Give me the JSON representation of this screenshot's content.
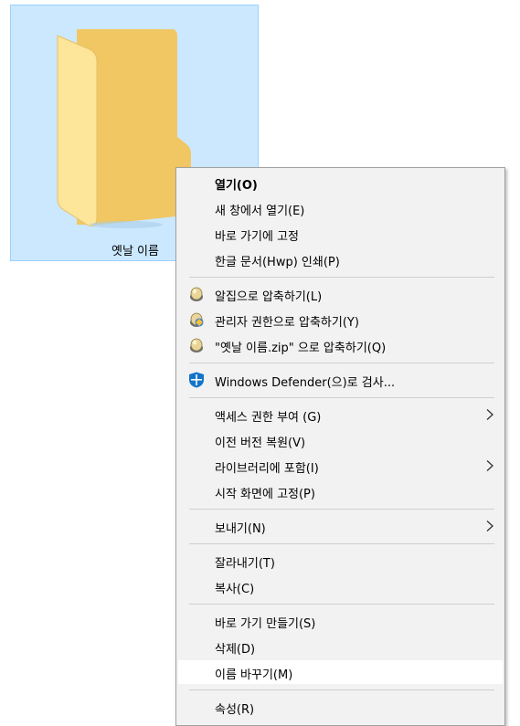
{
  "folder": {
    "name": "옛날 이름"
  },
  "menu": {
    "groups": [
      [
        {
          "label": "열기(O)",
          "icon": "",
          "submenu": false,
          "bold": true
        },
        {
          "label": "새 창에서 열기(E)",
          "icon": "",
          "submenu": false
        },
        {
          "label": "바로 가기에 고정",
          "icon": "",
          "submenu": false
        },
        {
          "label": "한글 문서(Hwp) 인쇄(P)",
          "icon": "",
          "submenu": false
        }
      ],
      [
        {
          "label": "알집으로 압축하기(L)",
          "icon": "alzip-icon",
          "submenu": false
        },
        {
          "label": "관리자 권한으로 압축하기(Y)",
          "icon": "alzip-admin-icon",
          "submenu": false
        },
        {
          "label": "\"옛날 이름.zip\" 으로 압축하기(Q)",
          "icon": "alzip-icon",
          "submenu": false
        }
      ],
      [
        {
          "label": "Windows Defender(으)로 검사...",
          "icon": "windows-defender-icon",
          "submenu": false
        }
      ],
      [
        {
          "label": "액세스 권한 부여 (G)",
          "icon": "",
          "submenu": true
        },
        {
          "label": "이전 버전 복원(V)",
          "icon": "",
          "submenu": false
        },
        {
          "label": "라이브러리에 포함(I)",
          "icon": "",
          "submenu": true
        },
        {
          "label": "시작 화면에 고정(P)",
          "icon": "",
          "submenu": false
        }
      ],
      [
        {
          "label": "보내기(N)",
          "icon": "",
          "submenu": true
        }
      ],
      [
        {
          "label": "잘라내기(T)",
          "icon": "",
          "submenu": false
        },
        {
          "label": "복사(C)",
          "icon": "",
          "submenu": false
        }
      ],
      [
        {
          "label": "바로 가기 만들기(S)",
          "icon": "",
          "submenu": false
        },
        {
          "label": "삭제(D)",
          "icon": "",
          "submenu": false
        },
        {
          "label": "이름 바꾸기(M)",
          "icon": "",
          "submenu": false,
          "hovered": true
        }
      ],
      [
        {
          "label": "속성(R)",
          "icon": "",
          "submenu": false
        }
      ]
    ]
  }
}
